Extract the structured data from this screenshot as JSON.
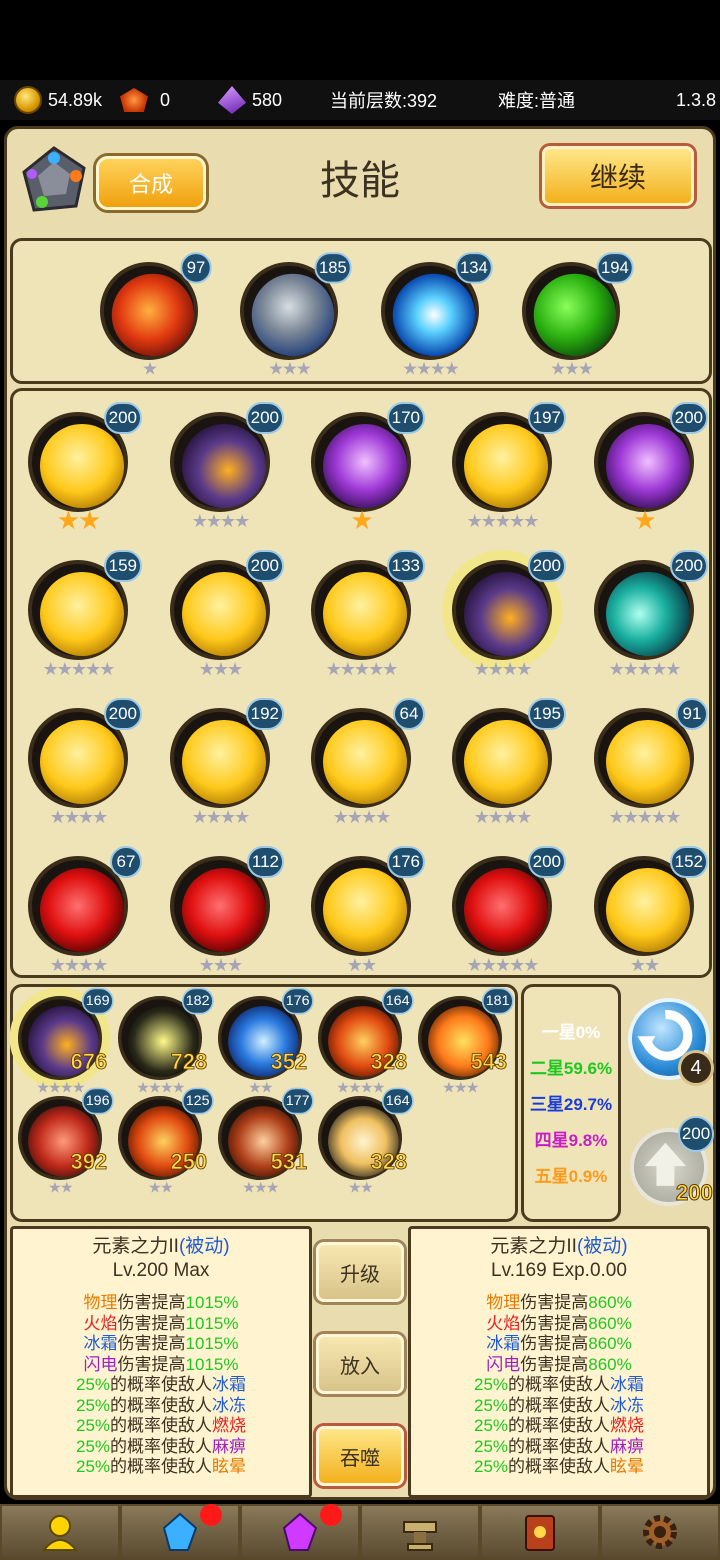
{
  "topbar": {
    "coins": "54.89k",
    "gems": "0",
    "crystals": "580",
    "floor_label": "当前层数:392",
    "difficulty_label": "难度:普通",
    "version": "1.3.8"
  },
  "header": {
    "combine_label": "合成",
    "title": "技能",
    "continue_label": "继续"
  },
  "equipped": [
    {
      "level": "97",
      "stars": "★",
      "element": "fire"
    },
    {
      "level": "185",
      "stars": "★★★",
      "element": "stone"
    },
    {
      "level": "134",
      "stars": "★★★★",
      "element": "ice"
    },
    {
      "level": "194",
      "stars": "★★★",
      "element": "poison"
    }
  ],
  "grid": [
    {
      "level": "200",
      "stars": "★★",
      "gold": true,
      "element": "gold"
    },
    {
      "level": "200",
      "stars": "★★★★",
      "gold": false,
      "element": "dark"
    },
    {
      "level": "170",
      "stars": "★",
      "gold": true,
      "element": "lightning"
    },
    {
      "level": "197",
      "stars": "★★★★★",
      "gold": false,
      "element": "gold"
    },
    {
      "level": "200",
      "stars": "★",
      "gold": true,
      "element": "lightning"
    },
    {
      "level": "159",
      "stars": "★★★★★",
      "gold": false,
      "element": "gold"
    },
    {
      "level": "200",
      "stars": "★★★",
      "gold": false,
      "element": "gold"
    },
    {
      "level": "133",
      "stars": "★★★★★",
      "gold": false,
      "element": "gold"
    },
    {
      "level": "200",
      "stars": "★★★★",
      "gold": false,
      "element": "dark",
      "selected": true
    },
    {
      "level": "200",
      "stars": "★★★★★",
      "gold": false,
      "element": "wind"
    },
    {
      "level": "200",
      "stars": "★★★★",
      "gold": false,
      "element": "gold"
    },
    {
      "level": "192",
      "stars": "★★★★",
      "gold": false,
      "element": "gold"
    },
    {
      "level": "64",
      "stars": "★★★★",
      "gold": false,
      "element": "gold"
    },
    {
      "level": "195",
      "stars": "★★★★",
      "gold": false,
      "element": "gold"
    },
    {
      "level": "91",
      "stars": "★★★★★",
      "gold": false,
      "element": "gold"
    },
    {
      "level": "67",
      "stars": "★★★★",
      "gold": false,
      "element": "blood"
    },
    {
      "level": "112",
      "stars": "★★★",
      "gold": false,
      "element": "blood"
    },
    {
      "level": "176",
      "stars": "★★",
      "gold": false,
      "element": "gold"
    },
    {
      "level": "200",
      "stars": "★★★★★",
      "gold": false,
      "element": "blood"
    },
    {
      "level": "152",
      "stars": "★★",
      "gold": false,
      "element": "gold"
    }
  ],
  "inventory": [
    {
      "level": "169",
      "count": "676",
      "stars": "★★★★",
      "element": "dark",
      "selected": true
    },
    {
      "level": "182",
      "count": "728",
      "stars": "★★★★",
      "element": "shock"
    },
    {
      "level": "176",
      "count": "352",
      "stars": "★★",
      "element": "ice2"
    },
    {
      "level": "164",
      "count": "328",
      "stars": "★★★★",
      "element": "burn"
    },
    {
      "level": "181",
      "count": "543",
      "stars": "★★★",
      "element": "holy"
    },
    {
      "level": "196",
      "count": "392",
      "stars": "★★",
      "element": "red"
    },
    {
      "level": "125",
      "count": "250",
      "stars": "★★",
      "element": "burn"
    },
    {
      "level": "177",
      "count": "531",
      "stars": "★★★",
      "element": "slash"
    },
    {
      "level": "164",
      "count": "328",
      "stars": "★★",
      "element": "shadow"
    }
  ],
  "chance": [
    {
      "label": "一星0%",
      "color": "#ffffff"
    },
    {
      "label": "二星59.6%",
      "color": "#1ec81e"
    },
    {
      "label": "三星29.7%",
      "color": "#1a3cd6"
    },
    {
      "label": "四星9.8%",
      "color": "#c81ec8"
    },
    {
      "label": "五星0.9%",
      "color": "#ff9a1a"
    }
  ],
  "side": {
    "refresh_badge": "4",
    "upgrade_badge": "200",
    "upgrade_cost": "200"
  },
  "left_info": {
    "name": "元素之力II",
    "tag": "(被动)",
    "sub": "Lv.200 Max",
    "lines": [
      {
        "a": "物理",
        "ac": "#e87a00",
        "b": "伤害提高",
        "c": "1015%"
      },
      {
        "a": "火焰",
        "ac": "#e81e1e",
        "b": "伤害提高",
        "c": "1015%"
      },
      {
        "a": "冰霜",
        "ac": "#1e5ad6",
        "b": "伤害提高",
        "c": "1015%"
      },
      {
        "a": "闪电",
        "ac": "#a01ec8",
        "b": "伤害提高",
        "c": "1015%"
      }
    ],
    "chance_lines": [
      {
        "p": "25%",
        "t": "的概率使敌人",
        "e": "冰霜",
        "ec": "#1e5ad6"
      },
      {
        "p": "25%",
        "t": "的概率使敌人",
        "e": "冰冻",
        "ec": "#1e5ad6"
      },
      {
        "p": "25%",
        "t": "的概率使敌人",
        "e": "燃烧",
        "ec": "#e81e1e"
      },
      {
        "p": "25%",
        "t": "的概率使敌人",
        "e": "麻痹",
        "ec": "#a01ec8"
      },
      {
        "p": "25%",
        "t": "的概率使敌人",
        "e": "眩晕",
        "ec": "#e87a00"
      }
    ]
  },
  "right_info": {
    "name": "元素之力II",
    "tag": "(被动)",
    "sub": "Lv.169 Exp.0.00",
    "lines": [
      {
        "a": "物理",
        "ac": "#e87a00",
        "b": "伤害提高",
        "c": "860%"
      },
      {
        "a": "火焰",
        "ac": "#e81e1e",
        "b": "伤害提高",
        "c": "860%"
      },
      {
        "a": "冰霜",
        "ac": "#1e5ad6",
        "b": "伤害提高",
        "c": "860%"
      },
      {
        "a": "闪电",
        "ac": "#a01ec8",
        "b": "伤害提高",
        "c": "860%"
      }
    ],
    "chance_lines": [
      {
        "p": "25%",
        "t": "的概率使敌人",
        "e": "冰霜",
        "ec": "#1e5ad6"
      },
      {
        "p": "25%",
        "t": "的概率使敌人",
        "e": "冰冻",
        "ec": "#1e5ad6"
      },
      {
        "p": "25%",
        "t": "的概率使敌人",
        "e": "燃烧",
        "ec": "#e81e1e"
      },
      {
        "p": "25%",
        "t": "的概率使敌人",
        "e": "麻痹",
        "ec": "#a01ec8"
      },
      {
        "p": "25%",
        "t": "的概率使敌人",
        "e": "眩晕",
        "ec": "#e87a00"
      }
    ]
  },
  "actions": {
    "upgrade": "升级",
    "place": "放入",
    "devour": "吞噬"
  },
  "nav": [
    {
      "icon": "hero-icon",
      "dot": false
    },
    {
      "icon": "blue-gem-icon",
      "dot": true
    },
    {
      "icon": "purple-gem-icon",
      "dot": true
    },
    {
      "icon": "anvil-icon",
      "dot": false
    },
    {
      "icon": "book-icon",
      "dot": false
    },
    {
      "icon": "gear-icon",
      "dot": false
    }
  ]
}
